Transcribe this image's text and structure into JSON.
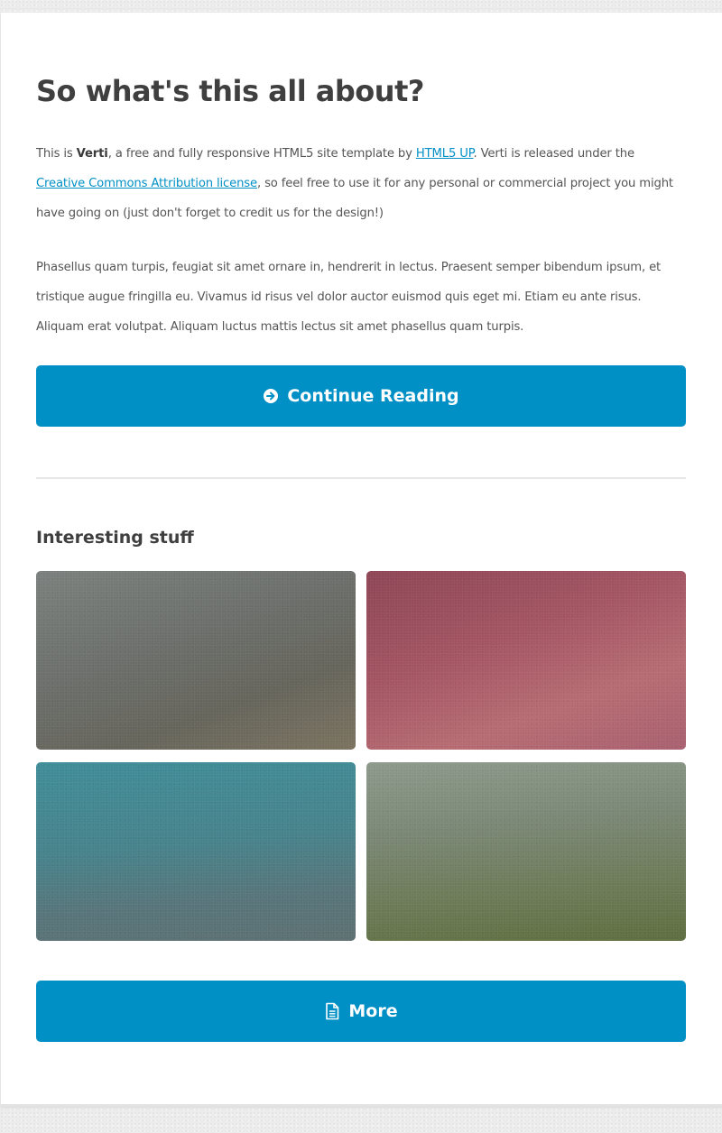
{
  "main": {
    "title": "So what's this all about?",
    "intro": {
      "p1_prefix": "This is ",
      "p1_brand": "Verti",
      "p1_mid": ", a free and fully responsive HTML5 site template by ",
      "p1_link_html5up": "HTML5 UP",
      "p1_mid2": ". Verti is released under the ",
      "p1_link_license": "Creative Commons Attribution license",
      "p1_suffix": ", so feel free to use it for any personal or commercial project you might have going on (just don't forget to credit us for the design!)"
    },
    "paragraph2": "Phasellus quam turpis, feugiat sit amet ornare in, hendrerit in lectus. Praesent semper bibendum ipsum, et tristique augue fringilla eu. Vivamus id risus vel dolor auctor euismod quis eget mi. Etiam eu ante risus. Aliquam erat volutpat. Aliquam luctus mattis lectus sit amet phasellus quam turpis.",
    "continue_button": {
      "label": "Continue Reading",
      "icon": "arrow-circle-right-icon"
    }
  },
  "gallery": {
    "heading": "Interesting stuff",
    "tiles": [
      {
        "name": "gallery-tile-1",
        "color": "#6f716b"
      },
      {
        "name": "gallery-tile-2",
        "color": "#a45564"
      },
      {
        "name": "gallery-tile-3",
        "color": "#4b818a"
      },
      {
        "name": "gallery-tile-4",
        "color": "#76836b"
      }
    ],
    "more_button": {
      "label": "More",
      "icon": "document-icon"
    }
  },
  "colors": {
    "accent": "#0090c5",
    "link": "#0090c5",
    "heading": "#3f3f3f",
    "text": "#555555",
    "panel": "#ffffff",
    "background": "#ececec"
  }
}
